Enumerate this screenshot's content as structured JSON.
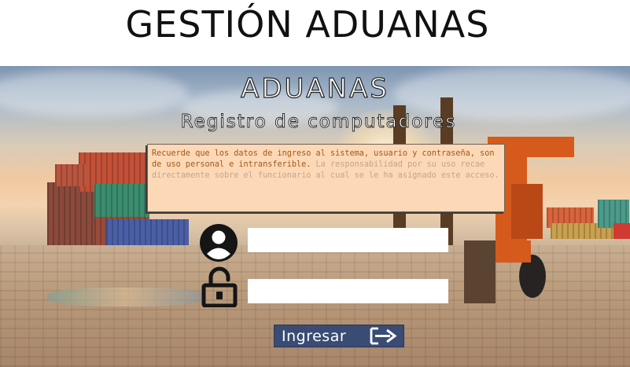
{
  "header": {
    "title": "GESTIÓN ADUANAS"
  },
  "brand": {
    "name": "ADUANAS",
    "subtitle": "Registro de computadores"
  },
  "notice": {
    "emphasis": "Recuerde que los datos de ingreso al sistema, usuario y contraseña, son de uso personal e intransferible.",
    "rest": " La responsabilidad por su uso recae directamente sobre el funcionario al cual se le ha asignado este acceso."
  },
  "login": {
    "username_value": "",
    "password_value": "",
    "submit_label": "Ingresar"
  },
  "icons": {
    "user": "user-circle-icon",
    "password": "unlock-icon",
    "submit": "sign-in-arrow-icon"
  },
  "colors": {
    "notice_background": "#fcd8b6",
    "notice_emphasis_text": "#a2581a",
    "button_background": "#3a4b74"
  }
}
